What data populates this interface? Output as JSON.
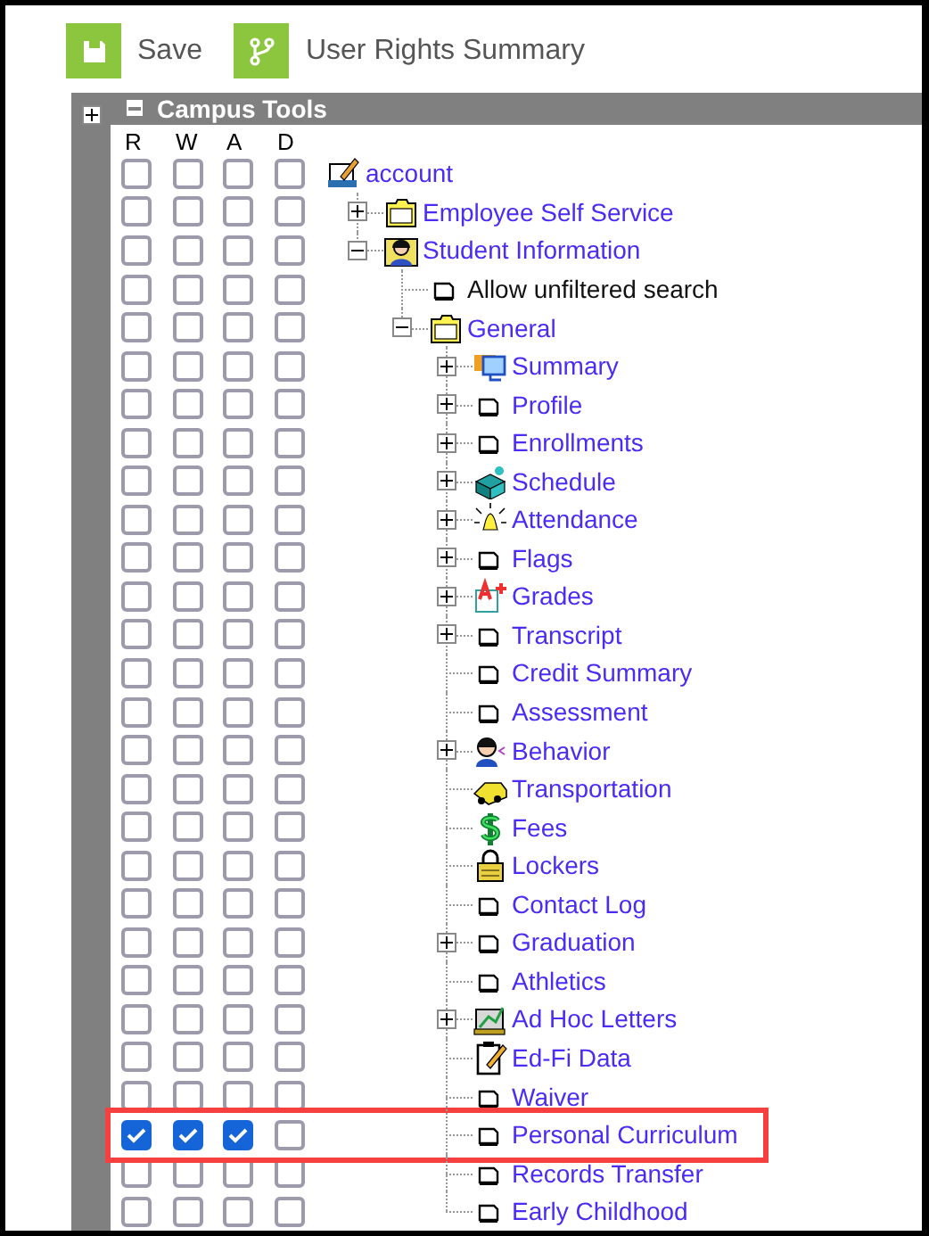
{
  "toolbar": {
    "buttons": [
      {
        "label": "Save"
      },
      {
        "label": "User Rights Summary"
      }
    ]
  },
  "campus_tools": {
    "title": "Campus Tools",
    "expanded": true,
    "side_expanded": false,
    "columns": [
      "R",
      "W",
      "A",
      "D"
    ],
    "tree": [
      {
        "label": "account",
        "kind": "edit",
        "highlighted": false,
        "rights": [
          {
            "checked": false
          },
          {
            "checked": false
          },
          {
            "checked": false
          },
          {
            "checked": false
          }
        ],
        "children": [
          {
            "label": "Employee Self Service",
            "kind": "folder",
            "expanded": false,
            "highlighted": false,
            "rights": [
              {
                "checked": false
              },
              {
                "checked": false
              },
              {
                "checked": false
              },
              {
                "checked": false
              }
            ]
          },
          {
            "label": "Student Information",
            "kind": "person",
            "expanded": true,
            "highlighted": false,
            "rights": [
              {
                "checked": false
              },
              {
                "checked": false
              },
              {
                "checked": false
              },
              {
                "checked": false
              }
            ],
            "children": [
              {
                "label": "Allow unfiltered search",
                "kind": "option",
                "highlighted": false,
                "rights": [
                  {
                    "checked": false
                  },
                  {
                    "checked": false
                  },
                  {
                    "checked": false
                  },
                  {
                    "checked": false
                  }
                ]
              },
              {
                "label": "General",
                "kind": "folder",
                "expanded": true,
                "highlighted": false,
                "rights": [
                  {
                    "checked": false
                  },
                  {
                    "checked": false
                  },
                  {
                    "checked": false
                  },
                  {
                    "checked": false
                  }
                ],
                "children": [
                  {
                    "label": "Summary",
                    "kind": "monitor",
                    "expanded": false,
                    "highlighted": false,
                    "rights": [
                      {
                        "checked": false
                      },
                      {
                        "checked": false
                      },
                      {
                        "checked": false
                      },
                      {
                        "checked": false
                      }
                    ]
                  },
                  {
                    "label": "Profile",
                    "kind": "page",
                    "expanded": false,
                    "highlighted": false,
                    "rights": [
                      {
                        "checked": false
                      },
                      {
                        "checked": false
                      },
                      {
                        "checked": false
                      },
                      {
                        "checked": false
                      }
                    ]
                  },
                  {
                    "label": "Enrollments",
                    "kind": "page",
                    "expanded": false,
                    "highlighted": false,
                    "rights": [
                      {
                        "checked": false
                      },
                      {
                        "checked": false
                      },
                      {
                        "checked": false
                      },
                      {
                        "checked": false
                      }
                    ]
                  },
                  {
                    "label": "Schedule",
                    "kind": "grid",
                    "expanded": false,
                    "highlighted": false,
                    "rights": [
                      {
                        "checked": false
                      },
                      {
                        "checked": false
                      },
                      {
                        "checked": false
                      },
                      {
                        "checked": false
                      }
                    ]
                  },
                  {
                    "label": "Attendance",
                    "kind": "bell",
                    "expanded": false,
                    "highlighted": false,
                    "rights": [
                      {
                        "checked": false
                      },
                      {
                        "checked": false
                      },
                      {
                        "checked": false
                      },
                      {
                        "checked": false
                      }
                    ]
                  },
                  {
                    "label": "Flags",
                    "kind": "page",
                    "expanded": false,
                    "highlighted": false,
                    "rights": [
                      {
                        "checked": false
                      },
                      {
                        "checked": false
                      },
                      {
                        "checked": false
                      },
                      {
                        "checked": false
                      }
                    ]
                  },
                  {
                    "label": "Grades",
                    "kind": "grade",
                    "expanded": false,
                    "highlighted": false,
                    "rights": [
                      {
                        "checked": false
                      },
                      {
                        "checked": false
                      },
                      {
                        "checked": false
                      },
                      {
                        "checked": false
                      }
                    ]
                  },
                  {
                    "label": "Transcript",
                    "kind": "page",
                    "expanded": false,
                    "highlighted": false,
                    "rights": [
                      {
                        "checked": false
                      },
                      {
                        "checked": false
                      },
                      {
                        "checked": false
                      },
                      {
                        "checked": false
                      }
                    ]
                  },
                  {
                    "label": "Credit Summary",
                    "kind": "page",
                    "highlighted": false,
                    "rights": [
                      {
                        "checked": false
                      },
                      {
                        "checked": false
                      },
                      {
                        "checked": false
                      },
                      {
                        "checked": false
                      }
                    ]
                  },
                  {
                    "label": "Assessment",
                    "kind": "page",
                    "highlighted": false,
                    "rights": [
                      {
                        "checked": false
                      },
                      {
                        "checked": false
                      },
                      {
                        "checked": false
                      },
                      {
                        "checked": false
                      }
                    ]
                  },
                  {
                    "label": "Behavior",
                    "kind": "student",
                    "expanded": false,
                    "highlighted": false,
                    "rights": [
                      {
                        "checked": false
                      },
                      {
                        "checked": false
                      },
                      {
                        "checked": false
                      },
                      {
                        "checked": false
                      }
                    ]
                  },
                  {
                    "label": "Transportation",
                    "kind": "car",
                    "highlighted": false,
                    "rights": [
                      {
                        "checked": false
                      },
                      {
                        "checked": false
                      },
                      {
                        "checked": false
                      },
                      {
                        "checked": false
                      }
                    ]
                  },
                  {
                    "label": "Fees",
                    "kind": "dollar",
                    "highlighted": false,
                    "rights": [
                      {
                        "checked": false
                      },
                      {
                        "checked": false
                      },
                      {
                        "checked": false
                      },
                      {
                        "checked": false
                      }
                    ]
                  },
                  {
                    "label": "Lockers",
                    "kind": "lock",
                    "highlighted": false,
                    "rights": [
                      {
                        "checked": false
                      },
                      {
                        "checked": false
                      },
                      {
                        "checked": false
                      },
                      {
                        "checked": false
                      }
                    ]
                  },
                  {
                    "label": "Contact Log",
                    "kind": "page",
                    "highlighted": false,
                    "rights": [
                      {
                        "checked": false
                      },
                      {
                        "checked": false
                      },
                      {
                        "checked": false
                      },
                      {
                        "checked": false
                      }
                    ]
                  },
                  {
                    "label": "Graduation",
                    "kind": "page",
                    "expanded": false,
                    "highlighted": false,
                    "rights": [
                      {
                        "checked": false
                      },
                      {
                        "checked": false
                      },
                      {
                        "checked": false
                      },
                      {
                        "checked": false
                      }
                    ]
                  },
                  {
                    "label": "Athletics",
                    "kind": "page",
                    "highlighted": false,
                    "rights": [
                      {
                        "checked": false
                      },
                      {
                        "checked": false
                      },
                      {
                        "checked": false
                      },
                      {
                        "checked": false
                      }
                    ]
                  },
                  {
                    "label": "Ad Hoc Letters",
                    "kind": "chart",
                    "expanded": false,
                    "highlighted": false,
                    "rights": [
                      {
                        "checked": false
                      },
                      {
                        "checked": false
                      },
                      {
                        "checked": false
                      },
                      {
                        "checked": false
                      }
                    ]
                  },
                  {
                    "label": "Ed-Fi Data",
                    "kind": "notepad",
                    "highlighted": false,
                    "rights": [
                      {
                        "checked": false
                      },
                      {
                        "checked": false
                      },
                      {
                        "checked": false
                      },
                      {
                        "checked": false
                      }
                    ]
                  },
                  {
                    "label": "Waiver",
                    "kind": "page",
                    "highlighted": false,
                    "rights": [
                      {
                        "checked": false
                      },
                      {
                        "checked": false
                      },
                      {
                        "checked": false
                      },
                      {
                        "checked": false
                      }
                    ]
                  },
                  {
                    "label": "Personal Curriculum",
                    "kind": "page",
                    "highlighted": true,
                    "rights": [
                      {
                        "checked": true
                      },
                      {
                        "checked": true
                      },
                      {
                        "checked": true
                      },
                      {
                        "checked": false
                      }
                    ]
                  },
                  {
                    "label": "Records Transfer",
                    "kind": "page",
                    "highlighted": false,
                    "rights": [
                      {
                        "checked": false
                      },
                      {
                        "checked": false
                      },
                      {
                        "checked": false
                      },
                      {
                        "checked": false
                      }
                    ]
                  },
                  {
                    "label": "Early Childhood",
                    "kind": "page",
                    "highlighted": false,
                    "rights": [
                      {
                        "checked": false
                      },
                      {
                        "checked": false
                      },
                      {
                        "checked": false
                      },
                      {
                        "checked": false
                      }
                    ]
                  }
                ]
              }
            ]
          }
        ]
      }
    ]
  }
}
